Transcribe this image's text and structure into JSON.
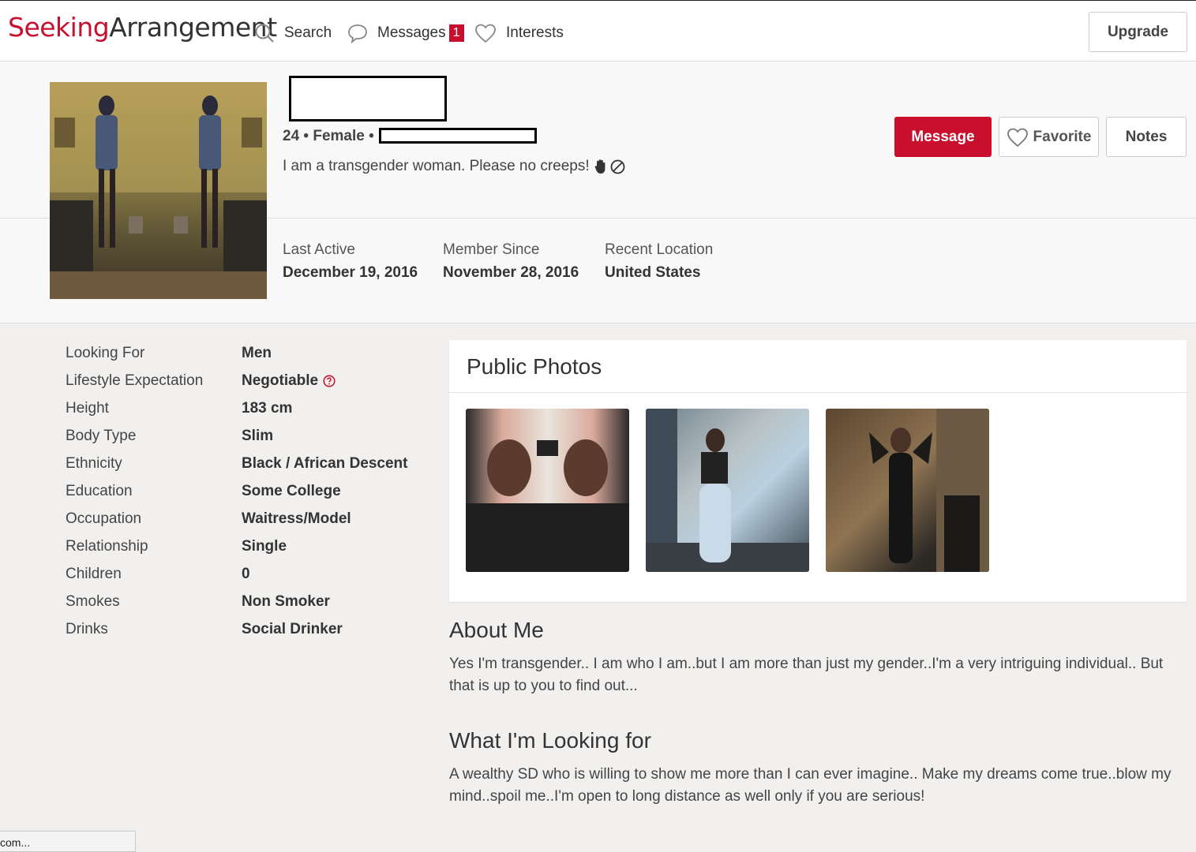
{
  "nav": {
    "logo_part1": "Seeking",
    "logo_part2": "Arrangement",
    "search_label": "Search",
    "messages_label": "Messages",
    "messages_count": "1",
    "interests_label": "Interests",
    "upgrade_label": "Upgrade"
  },
  "profile": {
    "meta": "24 • Female •",
    "tagline": "I am a transgender woman. Please no creeps!",
    "tagline_icons": [
      "raised-hand-icon",
      "no-entry-icon"
    ],
    "actions": {
      "message": "Message",
      "favorite": "Favorite",
      "notes": "Notes"
    },
    "stats": {
      "last_active_label": "Last Active",
      "last_active_value": "December 19, 2016",
      "member_since_label": "Member Since",
      "member_since_value": "November 28, 2016",
      "location_label": "Recent Location",
      "location_value": "United States"
    }
  },
  "details": [
    {
      "label": "Looking For",
      "value": "Men"
    },
    {
      "label": "Lifestyle Expectation",
      "value": "Negotiable"
    },
    {
      "label": "Height",
      "value": "183 cm"
    },
    {
      "label": "Body Type",
      "value": "Slim"
    },
    {
      "label": "Ethnicity",
      "value": "Black / African Descent"
    },
    {
      "label": "Education",
      "value": "Some College"
    },
    {
      "label": "Occupation",
      "value": "Waitress/Model"
    },
    {
      "label": "Relationship",
      "value": "Single"
    },
    {
      "label": "Children",
      "value": "0"
    },
    {
      "label": "Smokes",
      "value": "Non Smoker"
    },
    {
      "label": "Drinks",
      "value": "Social Drinker"
    }
  ],
  "photos": {
    "title": "Public Photos",
    "count": 3
  },
  "about": {
    "title": "About Me",
    "body": "Yes I'm transgender.. I am who I am..but I am more than just my gender..I'm a very intriguing individual.. But that is up to you to find out..."
  },
  "looking": {
    "title": "What I'm Looking for",
    "body": "A wealthy SD who is willing to show me more than I can ever imagine.. Make my dreams come true..blow my mind..spoil me..I'm open to long distance as well only if you are serious!"
  },
  "statusbar": {
    "text": "com..."
  },
  "colors": {
    "brand_red": "#c8102e",
    "page_bg": "#f1f0ef",
    "card_bg": "#ffffff"
  }
}
